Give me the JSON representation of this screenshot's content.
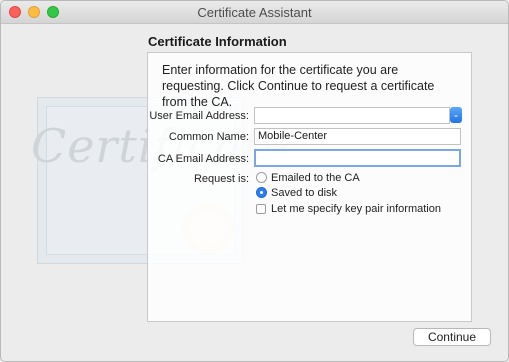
{
  "window": {
    "title": "Certificate Assistant"
  },
  "heading": "Certificate Information",
  "intro": "Enter information for the certificate you are requesting. Click Continue to request a certificate from the CA.",
  "form": {
    "user_email": {
      "label": "User Email Address:",
      "value": ""
    },
    "common_name": {
      "label": "Common Name:",
      "value": "Mobile-Center"
    },
    "ca_email": {
      "label": "CA Email Address:",
      "value": ""
    },
    "request": {
      "label": "Request is:",
      "options": [
        {
          "label": "Emailed to the CA",
          "selected": false
        },
        {
          "label": "Saved to disk",
          "selected": true
        }
      ]
    },
    "key_pair": {
      "label": "Let me specify key pair information",
      "checked": false
    }
  },
  "buttons": {
    "continue": "Continue"
  },
  "artwork": {
    "script_text": "Certificate"
  },
  "colors": {
    "accent": "#2b7ff0",
    "focus": "#7aa7e8"
  },
  "icons": {
    "dropdown": "chevron-updown-icon"
  }
}
